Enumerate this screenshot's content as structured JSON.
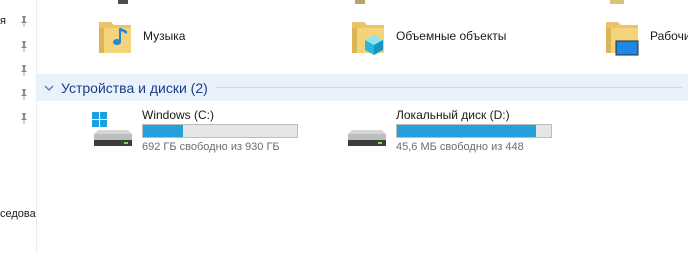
{
  "nav": {
    "fragment_top": "я",
    "fragment_bottom": "седова"
  },
  "folders": [
    {
      "label": "Музыка",
      "icon": "music-folder-icon"
    },
    {
      "label": "Объемные объекты",
      "icon": "3d-objects-folder-icon"
    },
    {
      "label": "Рабочи",
      "icon": "desktop-folder-icon"
    }
  ],
  "group": {
    "title": "Устройства и диски (2)"
  },
  "drives": [
    {
      "name": "Windows (C:)",
      "usage": "692 ГБ свободно из 930 ГБ",
      "used_fraction": 0.26,
      "icon": "windows-drive-icon"
    },
    {
      "name": "Локальный диск (D:)",
      "usage": "45,6 МБ свободно из 448",
      "used_fraction": 0.9,
      "icon": "local-disk-icon"
    }
  ],
  "colors": {
    "bar_fill": "#26a0da",
    "group_title": "#1e3b8a",
    "group_bg": "#e9f2fb"
  }
}
